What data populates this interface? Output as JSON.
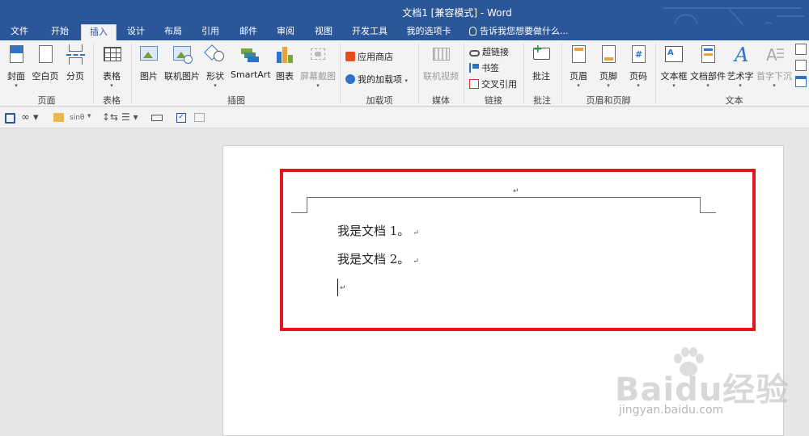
{
  "window": {
    "title": "文档1 [兼容模式] - Word"
  },
  "tabs": [
    {
      "label": "文件"
    },
    {
      "label": "开始"
    },
    {
      "label": "插入"
    },
    {
      "label": "设计"
    },
    {
      "label": "布局"
    },
    {
      "label": "引用"
    },
    {
      "label": "邮件"
    },
    {
      "label": "审阅"
    },
    {
      "label": "视图"
    },
    {
      "label": "开发工具"
    },
    {
      "label": "我的选项卡"
    }
  ],
  "active_tab": "插入",
  "tell_me": "告诉我您想要做什么...",
  "ribbon": {
    "pages": {
      "label": "页面",
      "cover": "封面",
      "blank": "空白页",
      "break": "分页"
    },
    "tables": {
      "label": "表格",
      "table": "表格"
    },
    "illustrations": {
      "label": "插图",
      "picture": "图片",
      "online_picture": "联机图片",
      "shapes": "形状",
      "smartart": "SmartArt",
      "chart": "图表",
      "screenshot": "屏幕截图"
    },
    "addins": {
      "label": "加载项",
      "store": "应用商店",
      "my_addins": "我的加载项"
    },
    "media": {
      "label": "媒体",
      "online_video": "联机视频"
    },
    "links": {
      "label": "链接",
      "hyperlink": "超链接",
      "bookmark": "书签",
      "cross_ref": "交叉引用"
    },
    "comments": {
      "label": "批注",
      "comment": "批注"
    },
    "header_footer": {
      "label": "页眉和页脚",
      "header": "页眉",
      "footer": "页脚",
      "page_number": "页码"
    },
    "text": {
      "label": "文本",
      "textbox": "文本框",
      "quick_parts": "文档部件",
      "wordart": "艺术字",
      "dropcap": "首字下沉"
    }
  },
  "qat": {
    "formula_hint": "sinθ"
  },
  "document": {
    "header_mark": "↵",
    "lines": [
      "我是文档 1。",
      "我是文档 2。"
    ],
    "para_mark": "↵"
  },
  "watermark": {
    "logo": "Baidu经验",
    "url": "jingyan.baidu.com"
  },
  "colors": {
    "titlebar": "#2b579a",
    "highlight_box": "#e3161b",
    "ribbon_bg": "#f3f3f3"
  }
}
